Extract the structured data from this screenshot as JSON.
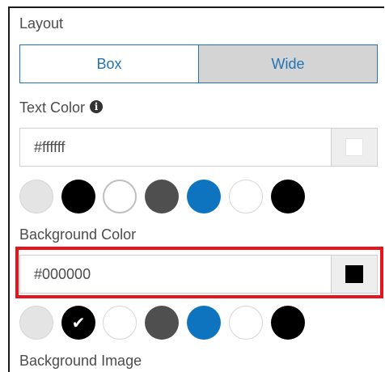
{
  "layout": {
    "label": "Layout",
    "options": [
      "Box",
      "Wide"
    ],
    "selected": "Wide"
  },
  "text_color": {
    "label": "Text Color",
    "info_icon": "info-icon",
    "value": "#ffffff",
    "swatch_color": "#ffffff",
    "palette": [
      "#e4e4e4",
      "#000000",
      "#ffffff",
      "#4f4f4f",
      "#0f74c0",
      "#ffffff",
      "#000000"
    ],
    "selected_index": 2
  },
  "background_color": {
    "label": "Background Color",
    "value": "#000000",
    "swatch_color": "#000000",
    "palette": [
      "#e4e4e4",
      "#000000",
      "#ffffff",
      "#4f4f4f",
      "#0f74c0",
      "#ffffff",
      "#000000"
    ],
    "selected_index": 1,
    "highlight_color": "#e8141c"
  },
  "background_image": {
    "label": "Background Image"
  },
  "accent_color": "#1f73b7"
}
